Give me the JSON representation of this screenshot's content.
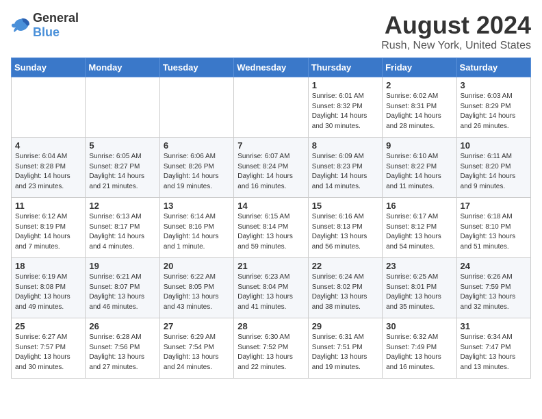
{
  "header": {
    "logo_general": "General",
    "logo_blue": "Blue",
    "month": "August 2024",
    "location": "Rush, New York, United States"
  },
  "days_of_week": [
    "Sunday",
    "Monday",
    "Tuesday",
    "Wednesday",
    "Thursday",
    "Friday",
    "Saturday"
  ],
  "weeks": [
    [
      {
        "day": "",
        "sunrise": "",
        "sunset": "",
        "daylight": ""
      },
      {
        "day": "",
        "sunrise": "",
        "sunset": "",
        "daylight": ""
      },
      {
        "day": "",
        "sunrise": "",
        "sunset": "",
        "daylight": ""
      },
      {
        "day": "",
        "sunrise": "",
        "sunset": "",
        "daylight": ""
      },
      {
        "day": "1",
        "sunrise": "6:01 AM",
        "sunset": "8:32 PM",
        "daylight": "14 hours and 30 minutes."
      },
      {
        "day": "2",
        "sunrise": "6:02 AM",
        "sunset": "8:31 PM",
        "daylight": "14 hours and 28 minutes."
      },
      {
        "day": "3",
        "sunrise": "6:03 AM",
        "sunset": "8:29 PM",
        "daylight": "14 hours and 26 minutes."
      }
    ],
    [
      {
        "day": "4",
        "sunrise": "6:04 AM",
        "sunset": "8:28 PM",
        "daylight": "14 hours and 23 minutes."
      },
      {
        "day": "5",
        "sunrise": "6:05 AM",
        "sunset": "8:27 PM",
        "daylight": "14 hours and 21 minutes."
      },
      {
        "day": "6",
        "sunrise": "6:06 AM",
        "sunset": "8:26 PM",
        "daylight": "14 hours and 19 minutes."
      },
      {
        "day": "7",
        "sunrise": "6:07 AM",
        "sunset": "8:24 PM",
        "daylight": "14 hours and 16 minutes."
      },
      {
        "day": "8",
        "sunrise": "6:09 AM",
        "sunset": "8:23 PM",
        "daylight": "14 hours and 14 minutes."
      },
      {
        "day": "9",
        "sunrise": "6:10 AM",
        "sunset": "8:22 PM",
        "daylight": "14 hours and 11 minutes."
      },
      {
        "day": "10",
        "sunrise": "6:11 AM",
        "sunset": "8:20 PM",
        "daylight": "14 hours and 9 minutes."
      }
    ],
    [
      {
        "day": "11",
        "sunrise": "6:12 AM",
        "sunset": "8:19 PM",
        "daylight": "14 hours and 7 minutes."
      },
      {
        "day": "12",
        "sunrise": "6:13 AM",
        "sunset": "8:17 PM",
        "daylight": "14 hours and 4 minutes."
      },
      {
        "day": "13",
        "sunrise": "6:14 AM",
        "sunset": "8:16 PM",
        "daylight": "14 hours and 1 minute."
      },
      {
        "day": "14",
        "sunrise": "6:15 AM",
        "sunset": "8:14 PM",
        "daylight": "13 hours and 59 minutes."
      },
      {
        "day": "15",
        "sunrise": "6:16 AM",
        "sunset": "8:13 PM",
        "daylight": "13 hours and 56 minutes."
      },
      {
        "day": "16",
        "sunrise": "6:17 AM",
        "sunset": "8:12 PM",
        "daylight": "13 hours and 54 minutes."
      },
      {
        "day": "17",
        "sunrise": "6:18 AM",
        "sunset": "8:10 PM",
        "daylight": "13 hours and 51 minutes."
      }
    ],
    [
      {
        "day": "18",
        "sunrise": "6:19 AM",
        "sunset": "8:08 PM",
        "daylight": "13 hours and 49 minutes."
      },
      {
        "day": "19",
        "sunrise": "6:21 AM",
        "sunset": "8:07 PM",
        "daylight": "13 hours and 46 minutes."
      },
      {
        "day": "20",
        "sunrise": "6:22 AM",
        "sunset": "8:05 PM",
        "daylight": "13 hours and 43 minutes."
      },
      {
        "day": "21",
        "sunrise": "6:23 AM",
        "sunset": "8:04 PM",
        "daylight": "13 hours and 41 minutes."
      },
      {
        "day": "22",
        "sunrise": "6:24 AM",
        "sunset": "8:02 PM",
        "daylight": "13 hours and 38 minutes."
      },
      {
        "day": "23",
        "sunrise": "6:25 AM",
        "sunset": "8:01 PM",
        "daylight": "13 hours and 35 minutes."
      },
      {
        "day": "24",
        "sunrise": "6:26 AM",
        "sunset": "7:59 PM",
        "daylight": "13 hours and 32 minutes."
      }
    ],
    [
      {
        "day": "25",
        "sunrise": "6:27 AM",
        "sunset": "7:57 PM",
        "daylight": "13 hours and 30 minutes."
      },
      {
        "day": "26",
        "sunrise": "6:28 AM",
        "sunset": "7:56 PM",
        "daylight": "13 hours and 27 minutes."
      },
      {
        "day": "27",
        "sunrise": "6:29 AM",
        "sunset": "7:54 PM",
        "daylight": "13 hours and 24 minutes."
      },
      {
        "day": "28",
        "sunrise": "6:30 AM",
        "sunset": "7:52 PM",
        "daylight": "13 hours and 22 minutes."
      },
      {
        "day": "29",
        "sunrise": "6:31 AM",
        "sunset": "7:51 PM",
        "daylight": "13 hours and 19 minutes."
      },
      {
        "day": "30",
        "sunrise": "6:32 AM",
        "sunset": "7:49 PM",
        "daylight": "13 hours and 16 minutes."
      },
      {
        "day": "31",
        "sunrise": "6:34 AM",
        "sunset": "7:47 PM",
        "daylight": "13 hours and 13 minutes."
      }
    ]
  ]
}
